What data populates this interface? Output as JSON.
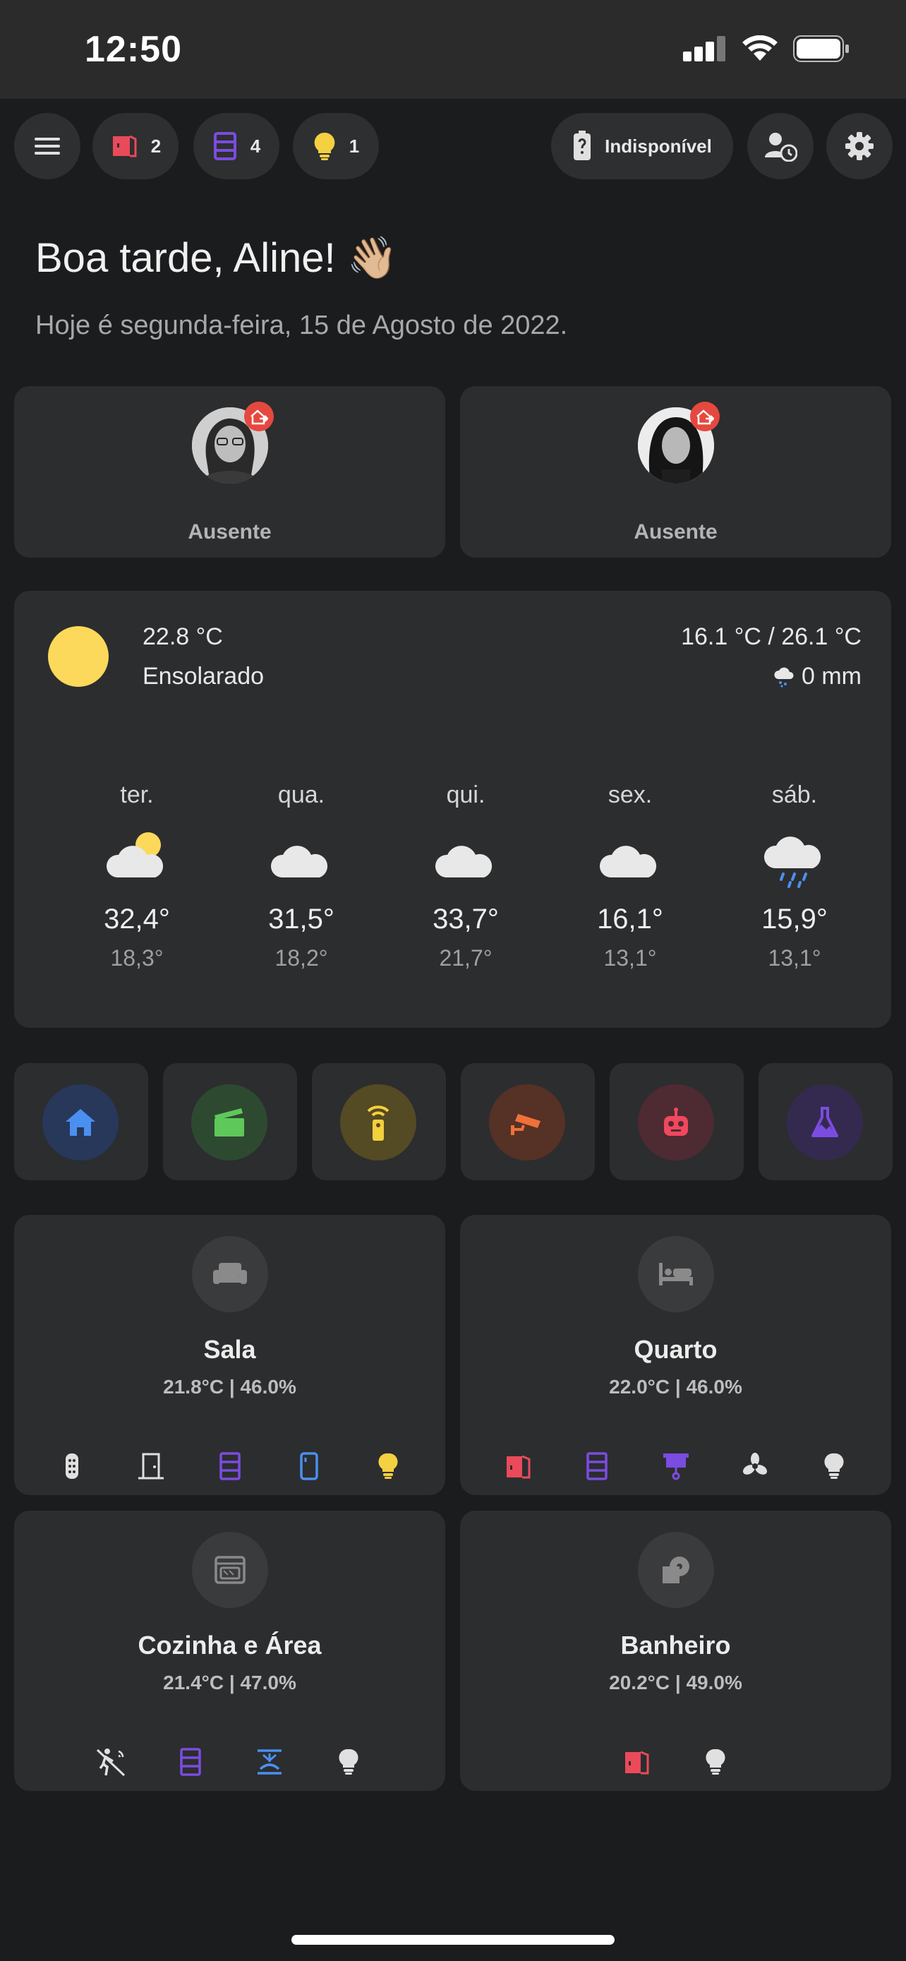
{
  "status_bar": {
    "time": "12:50"
  },
  "top_bar": {
    "doors_open_count": "2",
    "windows_open_count": "4",
    "lights_on_count": "1",
    "battery_status": "Indisponível"
  },
  "greeting": {
    "title": "Boa tarde, Aline! 👋🏼",
    "date": "Hoje é segunda-feira, 15 de Agosto de 2022."
  },
  "people": [
    {
      "state": "Ausente"
    },
    {
      "state": "Ausente"
    }
  ],
  "weather": {
    "current_temp": "22.8 °C",
    "condition": "Ensolarado",
    "range": "16.1 °C / 26.1 °C",
    "precipitation": "0 mm",
    "forecast": [
      {
        "day": "ter.",
        "icon": "partly-cloudy",
        "high": "32,4°",
        "low": "18,3°"
      },
      {
        "day": "qua.",
        "icon": "cloudy",
        "high": "31,5°",
        "low": "18,2°"
      },
      {
        "day": "qui.",
        "icon": "cloudy",
        "high": "33,7°",
        "low": "21,7°"
      },
      {
        "day": "sex.",
        "icon": "cloudy",
        "high": "16,1°",
        "low": "13,1°"
      },
      {
        "day": "sáb.",
        "icon": "rainy",
        "high": "15,9°",
        "low": "13,1°"
      }
    ]
  },
  "scenes": [
    {
      "icon": "home-icon",
      "color": "#4a90f0"
    },
    {
      "icon": "clapperboard-icon",
      "color": "#5ec85a"
    },
    {
      "icon": "remote-icon",
      "color": "#f4cf3e"
    },
    {
      "icon": "cctv-icon",
      "color": "#f0703a"
    },
    {
      "icon": "robot-icon",
      "color": "#f0485c"
    },
    {
      "icon": "flask-icon",
      "color": "#7b4ce0"
    }
  ],
  "rooms": [
    {
      "name": "Sala",
      "stats": "21.8°C | 46.0%",
      "icon": "sofa-icon"
    },
    {
      "name": "Quarto",
      "stats": "22.0°C | 46.0%",
      "icon": "bed-icon"
    },
    {
      "name": "Cozinha e Área",
      "stats": "21.4°C | 47.0%",
      "icon": "stove-icon"
    },
    {
      "name": "Banheiro",
      "stats": "20.2°C | 49.0%",
      "icon": "toilet-paper-icon"
    }
  ],
  "colors": {
    "door_open": "#ea4a5a",
    "window": "#7b4ce0",
    "light_on": "#f5d040",
    "blue": "#4a90f0",
    "badge_red": "#e5483f"
  }
}
